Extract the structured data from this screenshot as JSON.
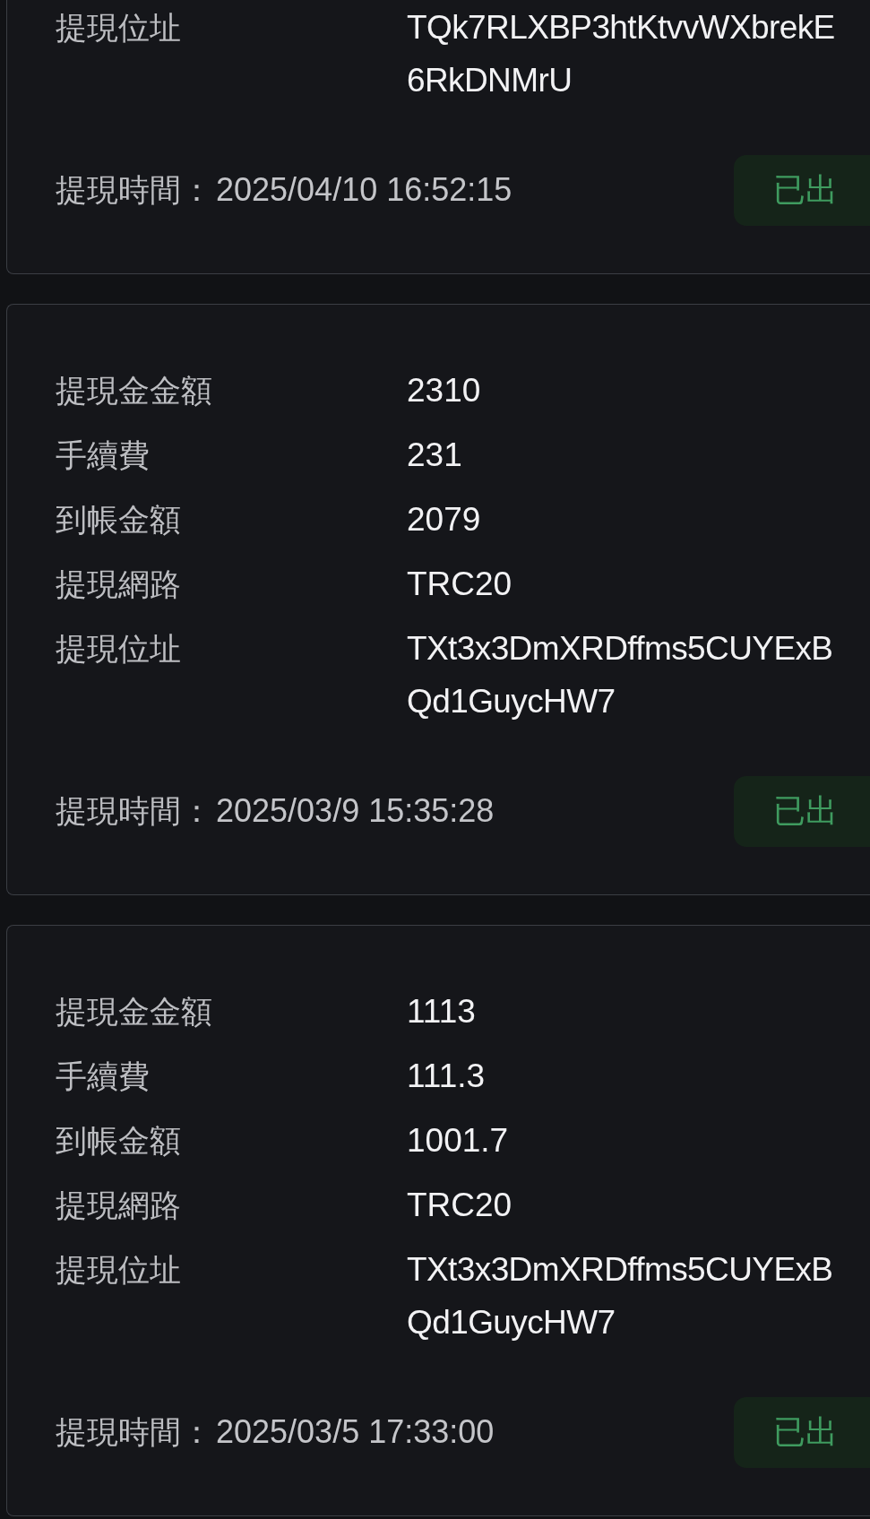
{
  "records": [
    {
      "fields": [
        {
          "kind": "address",
          "label": "提現位址",
          "lines": [
            "TQk7RLXBP3htKtvvWXbrekE",
            "6RkDNMrU"
          ]
        }
      ],
      "time_label": "提現時間：",
      "time": "2025/04/10 16:52:15",
      "status": "已出"
    },
    {
      "fields": [
        {
          "kind": "text",
          "label": "提現金金額",
          "value": "2310"
        },
        {
          "kind": "text",
          "label": "手續費",
          "value": "231"
        },
        {
          "kind": "text",
          "label": "到帳金額",
          "value": "2079"
        },
        {
          "kind": "text",
          "label": "提現網路",
          "value": "TRC20"
        },
        {
          "kind": "address",
          "label": "提現位址",
          "lines": [
            "TXt3x3DmXRDffms5CUYExB",
            "Qd1GuycHW7"
          ]
        }
      ],
      "time_label": "提現時間：",
      "time": "2025/03/9 15:35:28",
      "status": "已出"
    },
    {
      "fields": [
        {
          "kind": "text",
          "label": "提現金金額",
          "value": "1113"
        },
        {
          "kind": "text",
          "label": "手續費",
          "value": "111.3"
        },
        {
          "kind": "text",
          "label": "到帳金額",
          "value": "1001.7"
        },
        {
          "kind": "text",
          "label": "提現網路",
          "value": "TRC20"
        },
        {
          "kind": "address",
          "label": "提現位址",
          "lines": [
            "TXt3x3DmXRDffms5CUYExB",
            "Qd1GuycHW7"
          ]
        }
      ],
      "time_label": "提現時間：",
      "time": "2025/03/5 17:33:00",
      "status": "已出"
    }
  ]
}
